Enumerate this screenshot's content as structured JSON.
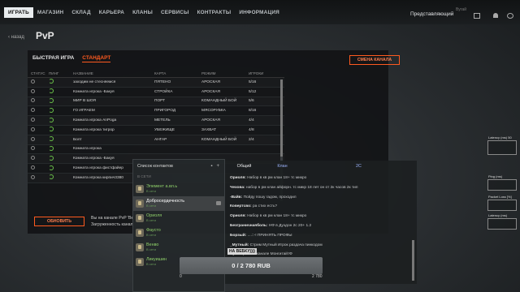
{
  "nav": {
    "items": [
      "ИГРАТЬ",
      "МАГАЗИН",
      "СКЛАД",
      "КАРЬЕРА",
      "КЛАНЫ",
      "СЕРВИСЫ",
      "КОНТРАКТЫ",
      "ИНФОРМАЦИЯ"
    ],
    "active_index": 0
  },
  "user": {
    "sub": "Вугай",
    "name": "Представляющий"
  },
  "back_label": "назад",
  "page_title": "PvP",
  "tabs": {
    "quick": "БЫСТРАЯ ИГРА",
    "standard": "СТАНДАРТ"
  },
  "change_channel": "СМЕНА КАНАЛА",
  "table": {
    "headers": [
      "СТАТУС",
      "ПИНГ",
      "НАЗВАНИЕ",
      "КАРТА",
      "РЕЖИМ",
      "ИГРОКИ"
    ],
    "rows": [
      {
        "name": "заходим не стесняемся",
        "map": "ПЯТЕНО",
        "mode": "АРОСКАЯ",
        "players": "5/16"
      },
      {
        "name": "Комната игрока -Бакуя",
        "map": "СТРОЙКА",
        "mode": "АРОСКАЯ",
        "players": "5/12"
      },
      {
        "name": "МИР В ШОЯ",
        "map": "ПОРТ",
        "mode": "КОМАНДНЫЙ БОЙ",
        "players": "5/6"
      },
      {
        "name": "ГО ИГРАЕМ",
        "map": "ПРИГОРОД",
        "mode": "МЯСОРУБКА",
        "players": "8/16"
      },
      {
        "name": "Комната игрока AnPoga",
        "map": "МЕТЕЛЬ",
        "mode": "АРОСКАЯ",
        "players": "4/4"
      },
      {
        "name": "Комната игрока тигрор",
        "map": "УБЕЖИЩЕ",
        "mode": "ЗАХВАТ",
        "players": "4/8"
      },
      {
        "name": "Болт",
        "map": "АНГАР",
        "mode": "КОМАНДНЫЙ БОЙ",
        "players": "2/4"
      },
      {
        "name": "Комната игрока",
        "map": "",
        "mode": "",
        "players": ""
      },
      {
        "name": "Комната игрока -Бакуя",
        "map": "",
        "mode": "",
        "players": ""
      },
      {
        "name": "Комната игрока фистфайер",
        "map": "",
        "mode": "",
        "players": ""
      },
      {
        "name": "Комната игрока кирпич3380",
        "map": "",
        "mode": "",
        "players": ""
      }
    ]
  },
  "refresh_label": "ОБНОВИТЬ",
  "channel_info": {
    "line1": "Вы на канале PvP 'Ве",
    "line2": "Загруженность канал"
  },
  "contacts": {
    "title": "Список контактов",
    "online_label": "В СЕТИ",
    "items": [
      {
        "nick": "Элемент а.вл.ь",
        "state": "В сети",
        "selected": false
      },
      {
        "nick": "Добросердечность",
        "state": "В сети",
        "selected": true
      },
      {
        "nick": "Ориоля",
        "state": "В сети",
        "selected": false
      },
      {
        "nick": "Фаусто",
        "state": "В сети",
        "selected": false
      },
      {
        "nick": "Венво",
        "state": "В сети",
        "selected": false
      },
      {
        "nick": "Ликуишин",
        "state": "В сети",
        "selected": false
      }
    ]
  },
  "chat": {
    "tabs": [
      "Общий",
      "Клан",
      "",
      "2С"
    ],
    "lines": [
      {
        "who": "Ориоля:",
        "text": "Набор в кв рм клан 18+ тс микро"
      },
      {
        "who": "Чехова:",
        "text": "набор в рм клан айфорн. тс микр 18 лет он от 2к часов 2к тип"
      },
      {
        "who": "-Вайв:",
        "text": "Пойду пошу гадом, проходил"
      },
      {
        "who": "Ковертсво:",
        "text": "ра стих есть?"
      },
      {
        "who": "Ориоля:",
        "text": "Набор в кв рм клан 18+ тс микро"
      },
      {
        "who": "Безграничнаяболь:",
        "text": "НФ в Дуэдон 2с 20+ 1.2"
      },
      {
        "who": "Борзый:",
        "text": "....::-! ПРИНЯТЬ ПРОФЫ"
      },
      {
        "who": "_Мутный:",
        "text": "Стрим Мутный Игрок раздача пинкодом"
      },
      {
        "who": "Пра",
        "text": "Стрим на канале МонгитайтФ"
      }
    ]
  },
  "tooltip": "НА ВЕБКУ))))",
  "wallet": {
    "label": "0 / 2 780 RUB",
    "min": "0",
    "max": "2 780"
  },
  "debug": [
    "Latency (ms) 50",
    "Ping (ms)",
    "Packet Loss [%]",
    "Latency (ms)"
  ]
}
